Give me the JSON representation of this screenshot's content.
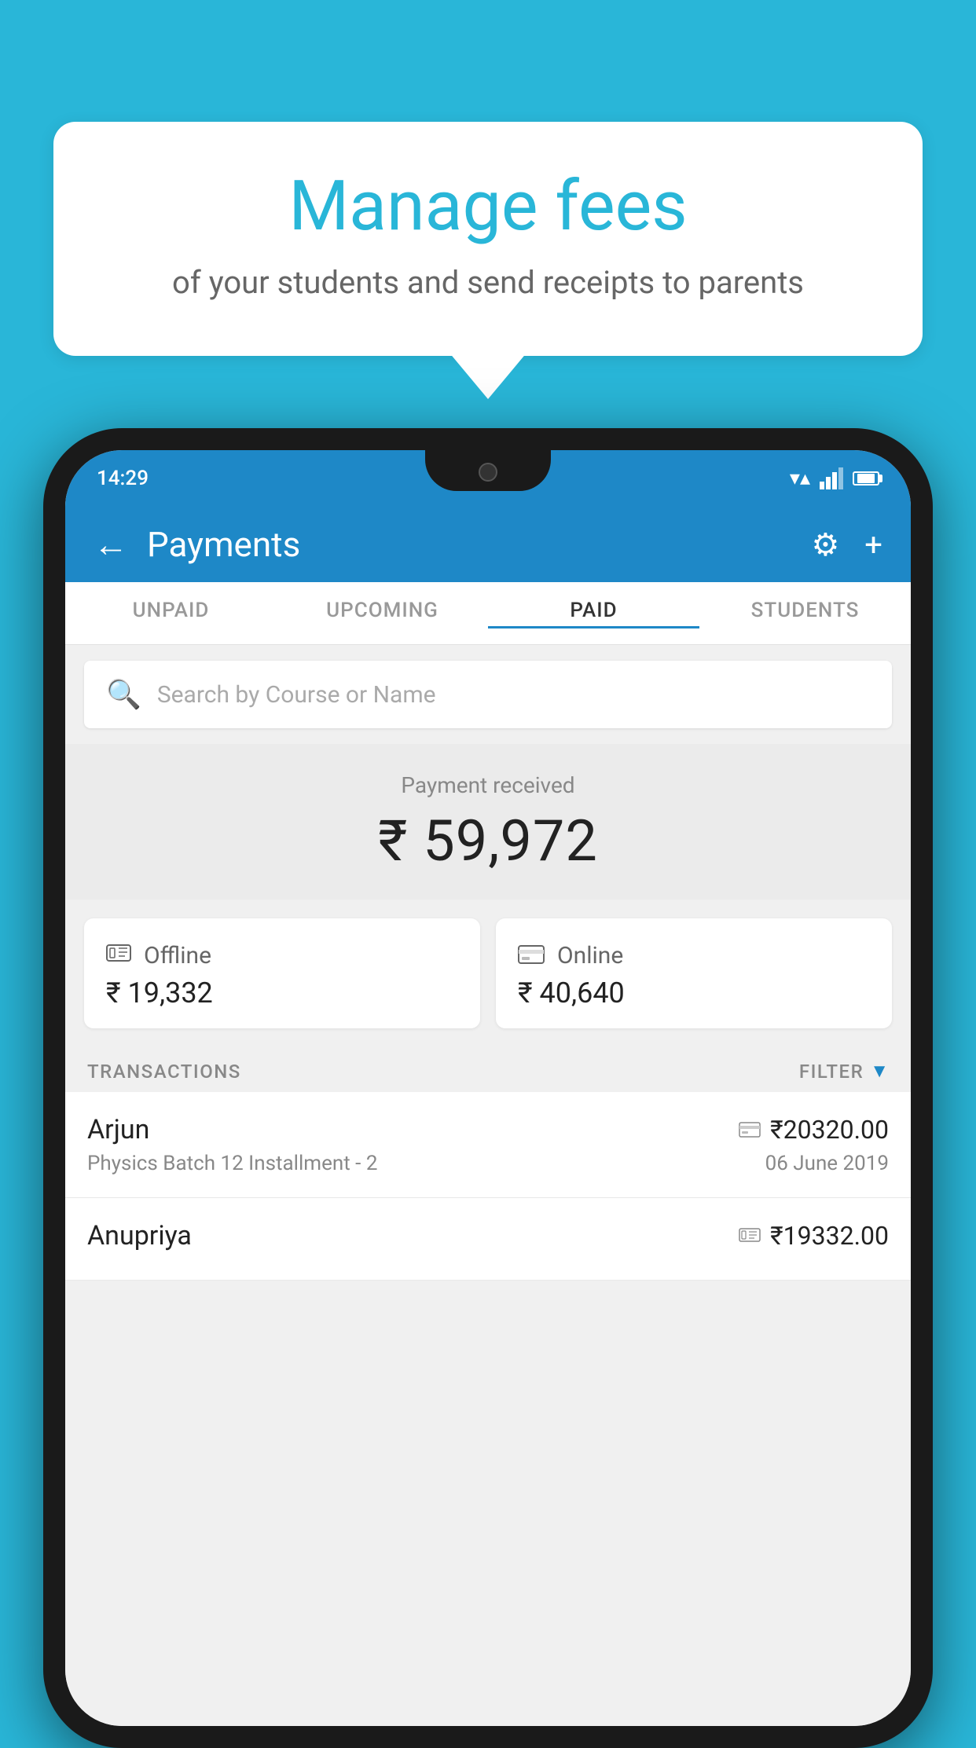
{
  "background_color": "#29b6d8",
  "bubble": {
    "title": "Manage fees",
    "subtitle": "of your students and send receipts to parents"
  },
  "status_bar": {
    "time": "14:29",
    "wifi": "▼",
    "signal": "▲",
    "battery": "▮"
  },
  "header": {
    "title": "Payments",
    "back_label": "←",
    "gear_label": "⚙",
    "plus_label": "+"
  },
  "tabs": [
    {
      "label": "UNPAID",
      "active": false
    },
    {
      "label": "UPCOMING",
      "active": false
    },
    {
      "label": "PAID",
      "active": true
    },
    {
      "label": "STUDENTS",
      "active": false
    }
  ],
  "search": {
    "placeholder": "Search by Course or Name"
  },
  "payment": {
    "label": "Payment received",
    "amount": "₹ 59,972"
  },
  "cards": [
    {
      "icon": "💳",
      "label": "Offline",
      "amount": "₹ 19,332"
    },
    {
      "icon": "💳",
      "label": "Online",
      "amount": "₹ 40,640"
    }
  ],
  "transactions": {
    "label": "TRANSACTIONS",
    "filter_label": "FILTER",
    "rows": [
      {
        "name": "Arjun",
        "icon": "💳",
        "amount": "₹20320.00",
        "course": "Physics Batch 12 Installment - 2",
        "date": "06 June 2019"
      },
      {
        "name": "Anupriya",
        "icon": "💵",
        "amount": "₹19332.00",
        "course": "",
        "date": ""
      }
    ]
  }
}
